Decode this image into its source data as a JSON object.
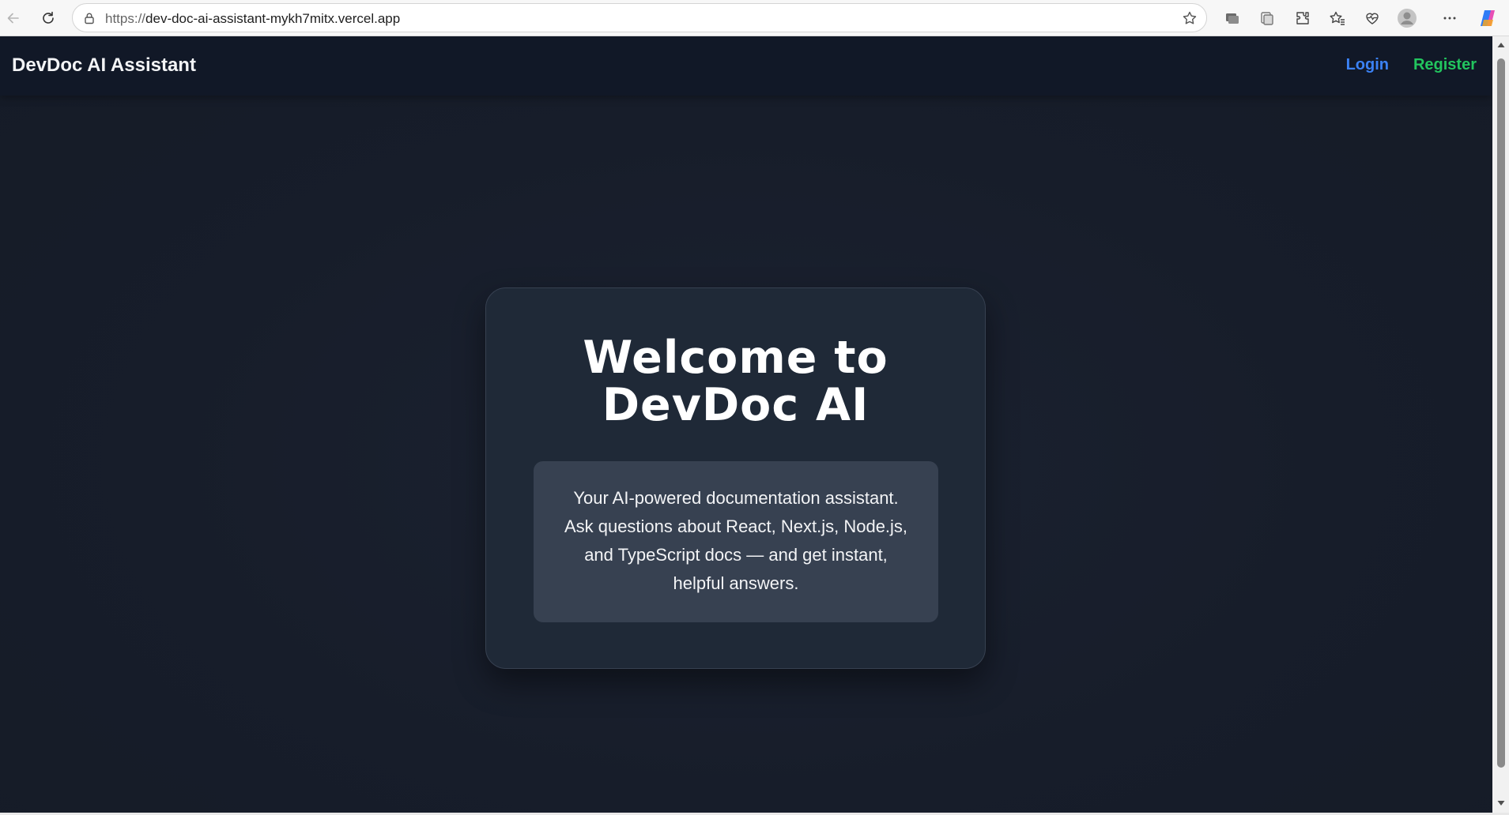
{
  "browser": {
    "url_scheme": "https://",
    "url_host": "dev-doc-ai-assistant-mykh7mitx.vercel.app",
    "icons": [
      "back-arrow-icon",
      "refresh-icon",
      "lock-icon",
      "star-icon",
      "chat-icon",
      "collections-icon",
      "extensions-icon",
      "favorites-icon",
      "health-icon",
      "profile-icon",
      "more-icon",
      "copilot-icon"
    ]
  },
  "header": {
    "brand": "DevDoc AI Assistant",
    "nav": {
      "login": "Login",
      "register": "Register"
    }
  },
  "hero": {
    "title_line1": "Welcome to",
    "title_line2": "DevDoc AI",
    "description": "Your AI-powered documentation assistant. Ask questions about React, Next.js, Node.js, and TypeScript docs — and get instant, helpful answers."
  },
  "colors": {
    "page_background": "#171d2a",
    "header_background": "#111827",
    "card_background": "#1f2937",
    "description_background": "#374151",
    "login_link": "#3b82f6",
    "register_link": "#22c55e",
    "text": "#ffffff"
  }
}
